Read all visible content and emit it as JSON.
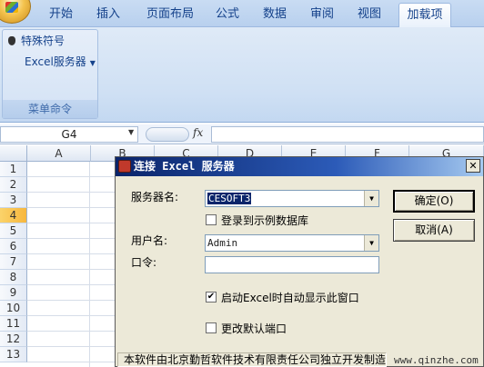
{
  "ribbon": {
    "tabs": [
      "开始",
      "插入",
      "页面布局",
      "公式",
      "数据",
      "审阅",
      "视图",
      "加载项"
    ],
    "active_tab": "加载项",
    "group": {
      "item_special_symbols": "特殊符号",
      "item_excel_server": "Excel服务器",
      "label": "菜单命令"
    }
  },
  "formula_bar": {
    "name_box": "G4",
    "fx": "fx",
    "formula": ""
  },
  "sheet": {
    "columns": [
      "A",
      "B",
      "C",
      "D",
      "E",
      "F",
      "G"
    ],
    "rows": [
      "1",
      "2",
      "3",
      "4",
      "5",
      "6",
      "7",
      "8",
      "9",
      "10",
      "11",
      "12",
      "13"
    ],
    "selected_row": "4"
  },
  "dialog": {
    "title": "连接 Excel 服务器",
    "close_glyph": "✕",
    "server_label": "服务器名:",
    "server_value": "CESOFT3",
    "login_demo_label": "登录到示例数据库",
    "login_demo_checked": false,
    "user_label": "用户名:",
    "user_value": "Admin",
    "password_label": "口令:",
    "password_value": "",
    "autostart_label": "启动Excel时自动显示此窗口",
    "autostart_checked": true,
    "change_port_label": "更改默认端口",
    "change_port_checked": false,
    "ok_label": "确定(O)",
    "cancel_label": "取消(A)",
    "status_text": "本软件由北京勤哲软件技术有限责任公司独立开发制造",
    "watermark": "www.qinzhe.com"
  }
}
